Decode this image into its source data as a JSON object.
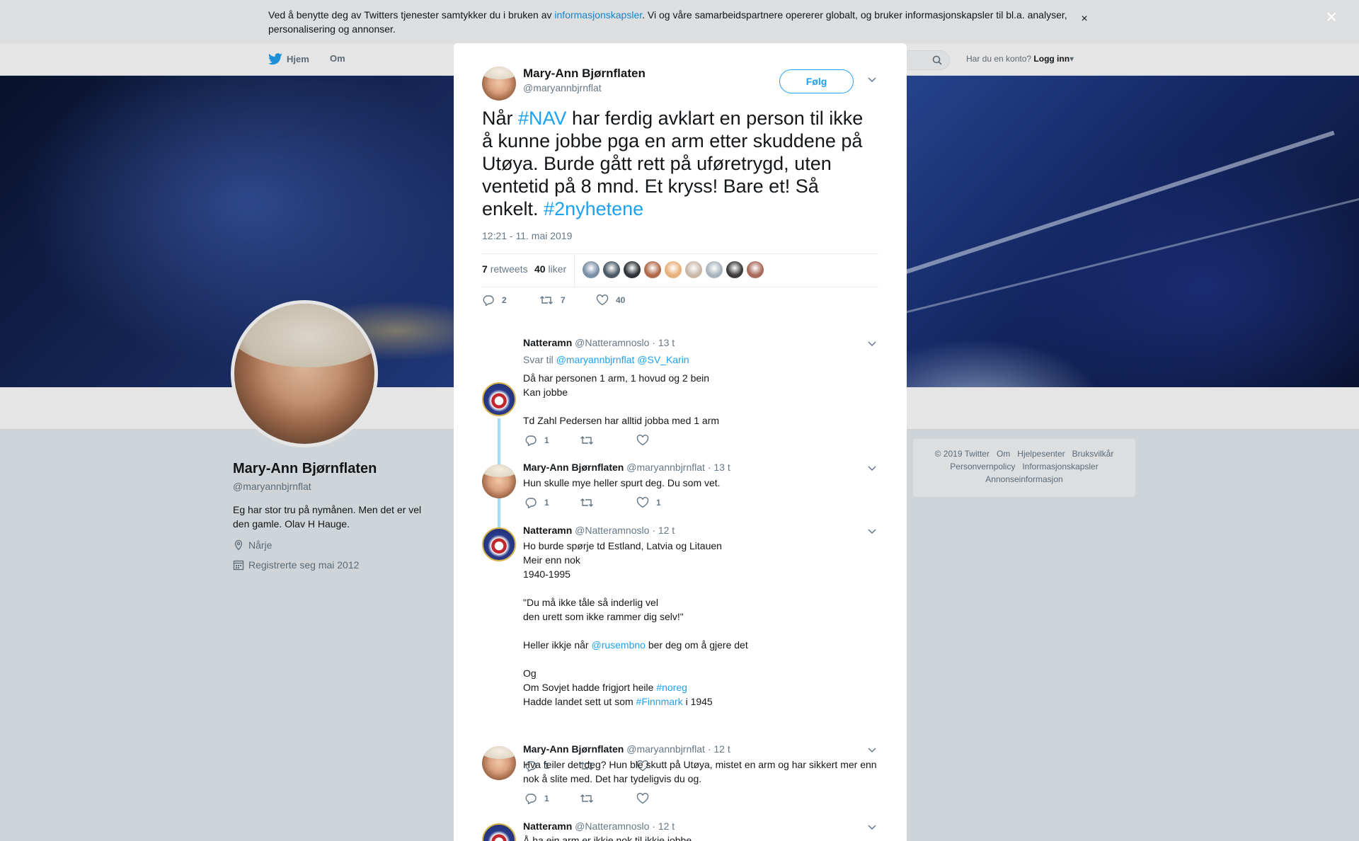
{
  "cookie": {
    "text_before": "Ved å benytte deg av Twitters tjenester samtykker du i bruken av ",
    "link": "informasjonskapsler",
    "text_after": ". Vi og våre samarbeidspartnere opererer globalt, og bruker informasjonskapsler til bl.a. analyser, personalisering og annonser.",
    "close": "×"
  },
  "nav": {
    "home": "Hjem",
    "about": "Om",
    "login_prompt": "Har du en konto?",
    "login": "Logg inn"
  },
  "profile": {
    "name": "Mary-Ann Bjørnflaten",
    "handle": "@maryannbjrnflat",
    "bio": "Eg har stor tru på nymånen. Men det er vel den gamle. Olav H Hauge.",
    "location": "Nårje",
    "joined": "Registrerte seg mai 2012"
  },
  "footer": {
    "links": [
      "© 2019 Twitter",
      "Om",
      "Hjelpesenter",
      "Bruksvilkår",
      "Personvernpolicy",
      "Informasjonskapsler",
      "Annonseinformasjon"
    ]
  },
  "overlay_close": "×",
  "tweet": {
    "author_name": "Mary-Ann Bjørnflaten",
    "author_handle": "@maryannbjrnflat",
    "follow_label": "Følg",
    "text_1": "Når ",
    "tag_1": "#NAV",
    "text_2": " har ferdig avklart en person til ikke å kunne jobbe pga en arm etter skuddene på Utøya. Burde gått rett på uføretrygd, uten ventetid på 8 mnd. Et kryss! Bare et! Så enkelt. ",
    "tag_2": "#2nyhetene",
    "time": "12:21 - 11. mai 2019",
    "retweets_count": "7",
    "retweets_label": "retweets",
    "likes_count": "40",
    "likes_label": "liker",
    "action_replies": "2",
    "action_retweets": "7",
    "action_likes": "40",
    "liker_colors": [
      "#7a8fa6",
      "#4a5a66",
      "#2e3338",
      "#b06a4a",
      "#e8b07a",
      "#c9b8a8",
      "#aab4be",
      "#3d3a3a",
      "#a86a5a"
    ]
  },
  "replies": [
    {
      "name": "Natteramn",
      "handle": "@Natteramnoslo",
      "time": "· 13 t",
      "replyto_prefix": "Svar til ",
      "replyto_mentions": "@maryannbjrnflat @SV_Karin",
      "body": "Då har personen 1 arm, 1 hovud og 2 bein\nKan jobbe\n\nTd Zahl Pedersen har alltid jobba med 1 arm",
      "reply_count": "1",
      "like_count": ""
    },
    {
      "name": "Mary-Ann Bjørnflaten",
      "handle": "@maryannbjrnflat",
      "time": "· 13 t",
      "body": "Hun skulle mye heller spurt deg. Du som vet.",
      "reply_count": "1",
      "like_count": "1"
    },
    {
      "name": "Natteramn",
      "handle": "@Natteramnoslo",
      "time": "· 12 t",
      "body_1": "Ho burde spørje td Estland, Latvia og Litauen\nMeir enn nok\n1940-1995\n\n\"Du må ikke tåle så inderlig vel\nden urett som ikke rammer dig selv!\"\n\nHeller ikkje når ",
      "mention": "@rusembno",
      "body_2": " ber deg om å gjere det\n\nOg\nOm Sovjet hadde frigjort heile ",
      "tag_1": "#noreg",
      "body_3": "\nHadde landet sett ut som ",
      "tag_2": "#Finnmark",
      "body_4": " i 1945",
      "reply_count": "1",
      "like_count": ""
    },
    {
      "name": "Mary-Ann Bjørnflaten",
      "handle": "@maryannbjrnflat",
      "time": "· 12 t",
      "body": "Hva feiler det deg? Hun ble skutt på Utøya, mistet en arm og har sikkert mer enn nok å slite med. Det har tydeligvis du og.",
      "reply_count": "1",
      "like_count": ""
    },
    {
      "name": "Natteramn",
      "handle": "@Natteramnoslo",
      "time": "· 12 t",
      "body": "Å ha ein arm er ikkje nok til ikkje jobbe"
    }
  ]
}
